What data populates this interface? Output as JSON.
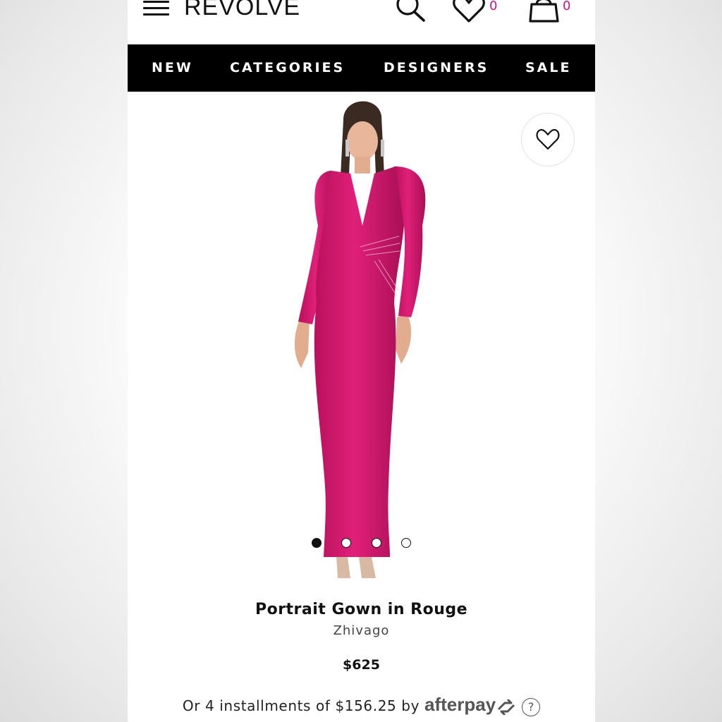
{
  "header": {
    "logo": "REVOLVE",
    "wishlist_count": "0",
    "cart_count": "0",
    "icons": [
      "menu-icon",
      "search-icon",
      "heart-icon",
      "shopping-bag-icon"
    ]
  },
  "nav": {
    "items": [
      {
        "label": "NEW"
      },
      {
        "label": "CATEGORIES"
      },
      {
        "label": "DESIGNERS"
      },
      {
        "label": "SALE"
      }
    ]
  },
  "product": {
    "name": "Portrait Gown in Rouge",
    "designer": "Zhivago",
    "price": "$625",
    "installments_text": "Or 4 installments of $156.25 by",
    "afterpay_label": "afterpay",
    "help_label": "?",
    "image_count": 4,
    "active_image": 1,
    "dress_color": "#d0186a"
  },
  "colors": {
    "badge": "#c7177f",
    "nav_bg": "#000000",
    "nav_text": "#ffffff"
  }
}
